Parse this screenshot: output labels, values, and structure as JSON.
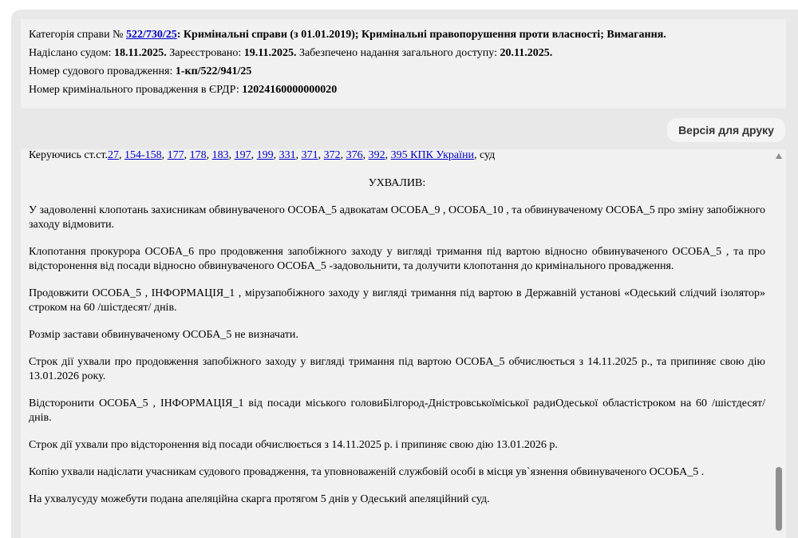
{
  "case_info": {
    "category_label": "Категорія справи № ",
    "category_link": "522/730/25",
    "category_text": ": Кримінальні справи (з 01.01.2019); Кримінальні правопорушення проти власності; Вимагання.",
    "sent_label": "Надіслано судом: ",
    "sent_date": "18.11.2025.",
    "registered_label": " Зареєстровано: ",
    "registered_date": "19.11.2025.",
    "access_label": " Забезпечено надання загального доступу: ",
    "access_date": "20.11.2025.",
    "proceeding_label": "Номер судового провадження: ",
    "proceeding_number": "1-кп/522/941/25",
    "erdr_label": "Номер кримінального провадження в ЄРДР: ",
    "erdr_number": "12024160000000020"
  },
  "toolbar": {
    "print_label": "Версія для друку"
  },
  "document": {
    "guided_prefix": "Керуючись ст.ст.",
    "article_links": [
      "27",
      "154-158",
      "177",
      "178",
      "183",
      "197",
      "199",
      "331",
      "371",
      "372",
      "376",
      "392",
      "395 КПК України"
    ],
    "separator": ", ",
    "guided_suffix": ", суд",
    "resolution_title": "УХВАЛИВ:",
    "paragraphs": [
      "У задоволенні клопотань захисникам обвинуваченого ОСОБА_5 адвокатам ОСОБА_9 , ОСОБА_10 , та обвинуваченому ОСОБА_5 про зміну запобіжного заходу відмовити.",
      "Клопотання прокурора ОСОБА_6 про продовження запобіжного заходу у вигляді тримання під вартою відносно обвинуваченого  ОСОБА_5 , та про відсторонення від посади відносно обвинуваченого  ОСОБА_5  -задовольнити, та долучити клопотання до кримінального провадження.",
      "Продовжити ОСОБА_5 , ІНФОРМАЦІЯ_1 , мірузапобіжного заходу у вигляді тримання під вартою в Державній установі «Одеський слідчий ізолятор» строком на 60 /шістдесят/ днів.",
      "Розмір застави обвинуваченому ОСОБА_5 не визначати.",
      "Строк дії ухвали про продовження запобіжного заходу у вигляді тримання під вартою ОСОБА_5 обчислюється з 14.11.2025 р., та припиняє свою дію 13.01.2026 року.",
      "Відсторонити  ОСОБА_5 , ІНФОРМАЦІЯ_1 від посади міського головиБілгород-Дністровськоїміської радиОдеської областістроком на 60 /шістдесят/ днів.",
      "Строк дії ухвали про відсторонення від посади обчислюється з 14.11.2025 р. і припиняє свою дію 13.01.2026 р.",
      "Копію ухвали надіслати учасникам судового провадження, та уповноваженій службовій особі в місця ув`язнення обвинуваченого ОСОБА_5 .",
      "На ухвалусуду можебути подана апеляційна скарга протягом 5 днів у Одеський апеляційний суд."
    ]
  }
}
